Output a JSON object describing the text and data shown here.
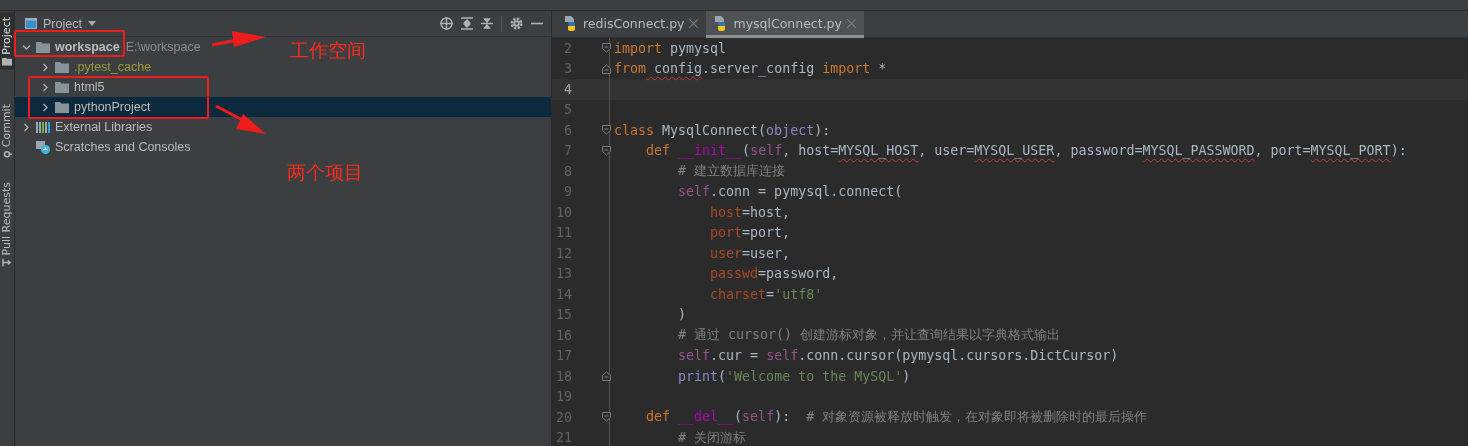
{
  "side_tabs": [
    {
      "label": "Project",
      "selected": true
    },
    {
      "label": "Commit",
      "selected": false
    },
    {
      "label": "Pull Requests",
      "selected": false
    }
  ],
  "project_panel": {
    "title": "Project",
    "tree": [
      {
        "label": "workspace",
        "path": "E:\\workspace",
        "kind": "folder",
        "expanded": true,
        "excluded": false,
        "selected": false,
        "children": [
          {
            "label": ".pytest_cache",
            "kind": "folder",
            "expanded": false,
            "excluded": true,
            "selected": false
          },
          {
            "label": "html5",
            "kind": "folder",
            "expanded": false,
            "excluded": false,
            "selected": false
          },
          {
            "label": "pythonProject",
            "kind": "folder",
            "expanded": false,
            "excluded": false,
            "selected": true
          }
        ]
      },
      {
        "label": "External Libraries",
        "kind": "libraries",
        "expanded": false,
        "excluded": false,
        "selected": false
      },
      {
        "label": "Scratches and Consoles",
        "kind": "scratches",
        "excluded": false,
        "selected": false
      }
    ]
  },
  "editor": {
    "tabs": [
      {
        "label": "redisConnect.py",
        "selected": false
      },
      {
        "label": "mysqlConnect.py",
        "selected": true
      }
    ],
    "lines": [
      {
        "number": "2",
        "current": false,
        "fold_start": true,
        "fold_end": false,
        "tokens": [
          {
            "kind": "kw",
            "text": "import"
          },
          {
            "kind": "plain",
            "text": " pymysql"
          }
        ]
      },
      {
        "number": "3",
        "current": false,
        "fold_start": false,
        "fold_end": true,
        "tokens": [
          {
            "kind": "kw",
            "text": "from"
          },
          {
            "kind": "warn",
            "text": " config"
          },
          {
            "kind": "plain",
            "text": ".server_config "
          },
          {
            "kind": "kw",
            "text": "import"
          },
          {
            "kind": "plain",
            "text": " *"
          }
        ]
      },
      {
        "number": "4",
        "current": true,
        "fold_start": false,
        "fold_end": false
      },
      {
        "number": "5",
        "current": false,
        "fold_start": false,
        "fold_end": false
      },
      {
        "number": "6",
        "current": false,
        "fold_start": true,
        "fold_end": false,
        "tokens": [
          {
            "kind": "kw",
            "text": "class"
          },
          {
            "kind": "plain",
            "text": " MysqlConnect("
          },
          {
            "kind": "builtin",
            "text": "object"
          },
          {
            "kind": "plain",
            "text": "):"
          }
        ]
      },
      {
        "number": "7",
        "current": false,
        "fold_start": true,
        "fold_end": false,
        "tokens": [
          {
            "kind": "kw",
            "text": "    def"
          },
          {
            "kind": "dunder",
            "text": " __init__"
          },
          {
            "kind": "plain",
            "text": "("
          },
          {
            "kind": "self",
            "text": "self"
          },
          {
            "kind": "plain",
            "text": ", host="
          },
          {
            "kind": "warn",
            "text": "MYSQL_HOST"
          },
          {
            "kind": "plain",
            "text": ", user="
          },
          {
            "kind": "warn",
            "text": "MYSQL_USER"
          },
          {
            "kind": "plain",
            "text": ", password="
          },
          {
            "kind": "warn",
            "text": "MYSQL_PASSWORD"
          },
          {
            "kind": "plain",
            "text": ", port="
          },
          {
            "kind": "warn",
            "text": "MYSQL_PORT"
          },
          {
            "kind": "plain",
            "text": "):"
          }
        ]
      },
      {
        "number": "8",
        "current": false,
        "fold_start": false,
        "fold_end": false,
        "tokens": [
          {
            "kind": "comment",
            "text": "        # 建立数据库连接"
          }
        ]
      },
      {
        "number": "9",
        "current": false,
        "fold_start": false,
        "fold_end": false,
        "tokens": [
          {
            "kind": "self",
            "text": "        self"
          },
          {
            "kind": "plain",
            "text": ".conn = pymysql.connect("
          }
        ]
      },
      {
        "number": "10",
        "current": false,
        "fold_start": false,
        "fold_end": false,
        "tokens": [
          {
            "kind": "param",
            "text": "            host"
          },
          {
            "kind": "plain",
            "text": "=host,"
          }
        ]
      },
      {
        "number": "11",
        "current": false,
        "fold_start": false,
        "fold_end": false,
        "tokens": [
          {
            "kind": "param",
            "text": "            port"
          },
          {
            "kind": "plain",
            "text": "=port,"
          }
        ]
      },
      {
        "number": "12",
        "current": false,
        "fold_start": false,
        "fold_end": false,
        "tokens": [
          {
            "kind": "param",
            "text": "            user"
          },
          {
            "kind": "plain",
            "text": "=user,"
          }
        ]
      },
      {
        "number": "13",
        "current": false,
        "fold_start": false,
        "fold_end": false,
        "tokens": [
          {
            "kind": "param",
            "text": "            passwd"
          },
          {
            "kind": "plain",
            "text": "=password,"
          }
        ]
      },
      {
        "number": "14",
        "current": false,
        "fold_start": false,
        "fold_end": false,
        "tokens": [
          {
            "kind": "param",
            "text": "            charset"
          },
          {
            "kind": "plain",
            "text": "="
          },
          {
            "kind": "string",
            "text": "'utf8'"
          }
        ]
      },
      {
        "number": "15",
        "current": false,
        "fold_start": false,
        "fold_end": false,
        "tokens": [
          {
            "kind": "plain",
            "text": "        )"
          }
        ]
      },
      {
        "number": "16",
        "current": false,
        "fold_start": false,
        "fold_end": false,
        "tokens": [
          {
            "kind": "comment",
            "text": "        # 通过 cursor() 创建游标对象，并让查询结果以字典格式输出"
          }
        ]
      },
      {
        "number": "17",
        "current": false,
        "fold_start": false,
        "fold_end": false,
        "tokens": [
          {
            "kind": "self",
            "text": "        self"
          },
          {
            "kind": "plain",
            "text": ".cur = "
          },
          {
            "kind": "self",
            "text": "self"
          },
          {
            "kind": "plain",
            "text": ".conn.cursor(pymysql.cursors.DictCursor)"
          }
        ]
      },
      {
        "number": "18",
        "current": false,
        "fold_start": false,
        "fold_end": true,
        "tokens": [
          {
            "kind": "builtin",
            "text": "        print"
          },
          {
            "kind": "plain",
            "text": "("
          },
          {
            "kind": "string",
            "text": "'Welcome to the MySQL'"
          },
          {
            "kind": "plain",
            "text": ")"
          }
        ]
      },
      {
        "number": "19",
        "current": false,
        "fold_start": false,
        "fold_end": false
      },
      {
        "number": "20",
        "current": false,
        "fold_start": true,
        "fold_end": false,
        "tokens": [
          {
            "kind": "kw",
            "text": "    def"
          },
          {
            "kind": "dunder",
            "text": " __del__"
          },
          {
            "kind": "plain",
            "text": "("
          },
          {
            "kind": "self",
            "text": "self"
          },
          {
            "kind": "plain",
            "text": "):  "
          },
          {
            "kind": "comment",
            "text": "# 对象资源被释放时触发，在对象即将被删除时的最后操作"
          }
        ]
      },
      {
        "number": "21",
        "current": false,
        "fold_start": false,
        "fold_end": false,
        "tokens": [
          {
            "kind": "comment",
            "text": "        # 关闭游标"
          }
        ]
      }
    ]
  },
  "annotations": [
    {
      "text": "工作空间"
    },
    {
      "text": "两个项目"
    }
  ]
}
